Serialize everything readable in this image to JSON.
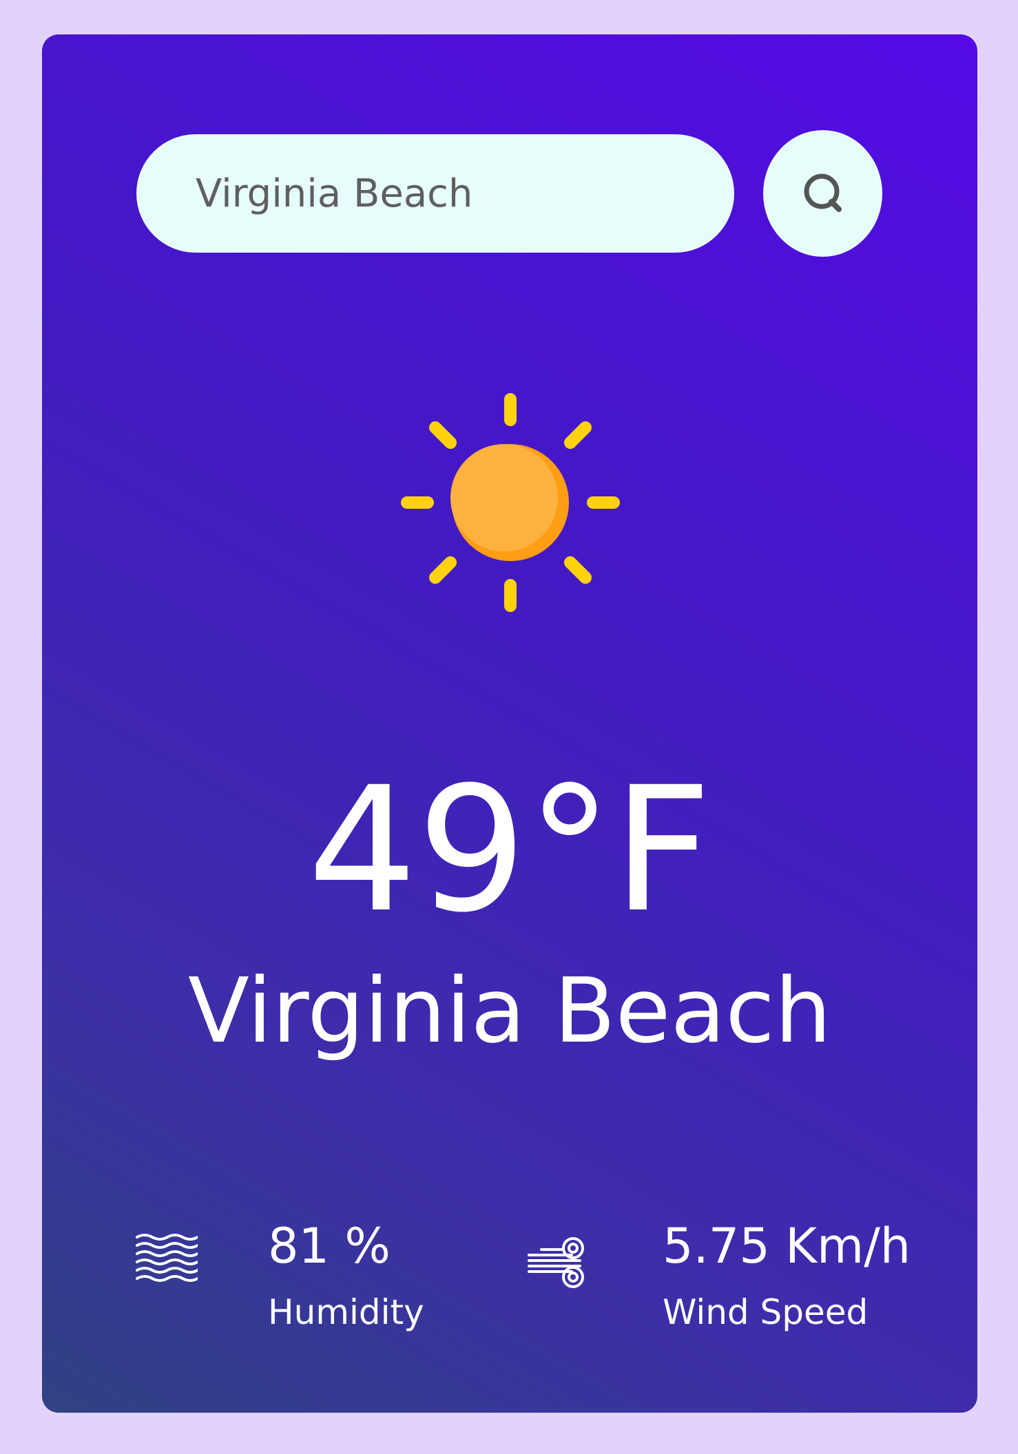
{
  "search": {
    "value": "Virginia Beach",
    "placeholder": "Virginia Beach",
    "icon": "search-icon"
  },
  "weather": {
    "icon": "sun-icon",
    "temperature": "49°F",
    "city": "Virginia Beach"
  },
  "details": {
    "humidity": {
      "icon": "waves-icon",
      "value": "81 %",
      "label": "Humidity"
    },
    "wind": {
      "icon": "wind-icon",
      "value": "5.75 Km/h",
      "label": "Wind Speed"
    }
  },
  "colors": {
    "page_background": "#e3d3fb",
    "card_gradient_top": "#550ae6",
    "card_gradient_bottom": "#2f4282",
    "input_background": "#e7fdfb",
    "sun_rays": "#ffd20c",
    "sun_core": "#fdb23f"
  }
}
